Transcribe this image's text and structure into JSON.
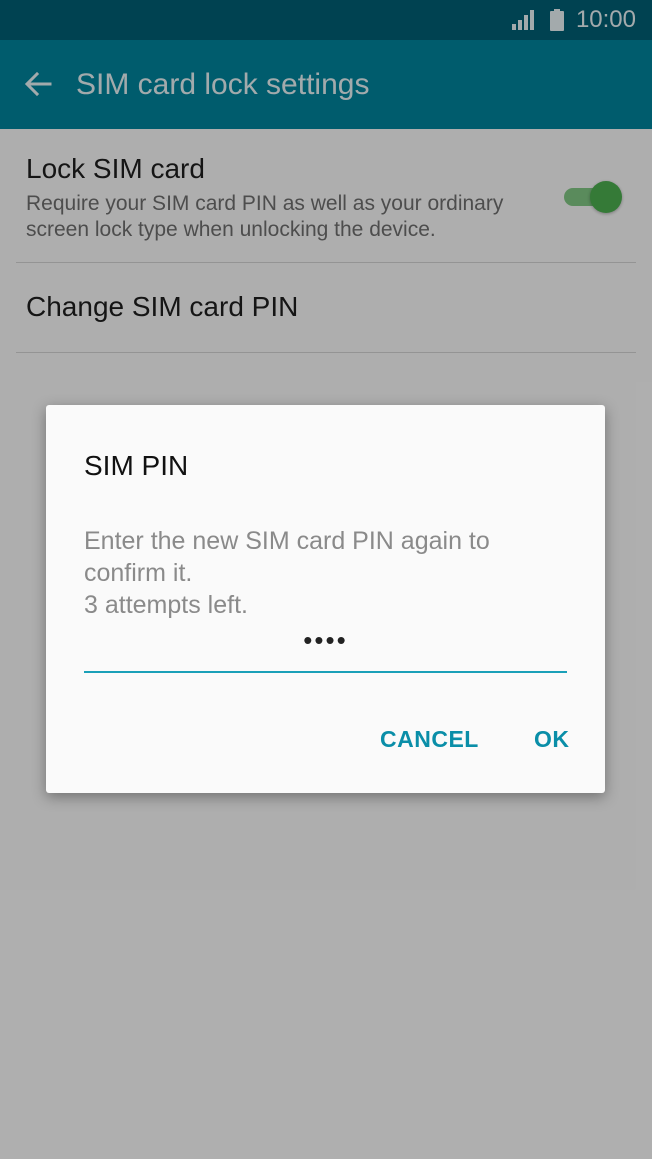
{
  "status_bar": {
    "time": "10:00",
    "signal_icon": "signal-icon",
    "battery_icon": "battery-icon"
  },
  "app_bar": {
    "title": "SIM card lock settings",
    "back_icon": "back-arrow-icon"
  },
  "preferences": [
    {
      "title": "Lock SIM card",
      "summary": "Require your SIM card PIN as well as your ordinary screen lock type when unlocking the device.",
      "toggle_on": true
    },
    {
      "title": "Change SIM card PIN"
    }
  ],
  "dialog": {
    "title": "SIM PIN",
    "message_line1": "Enter the new SIM card PIN again to",
    "message_line2": "confirm it.",
    "message_line3": "3 attempts left.",
    "pin_value": "••••",
    "cancel_label": "CANCEL",
    "ok_label": "OK"
  },
  "colors": {
    "status_bar": "#005f74",
    "app_bar": "#00849c",
    "accent": "#0a8ea8",
    "toggle_on": "#4caf50"
  }
}
